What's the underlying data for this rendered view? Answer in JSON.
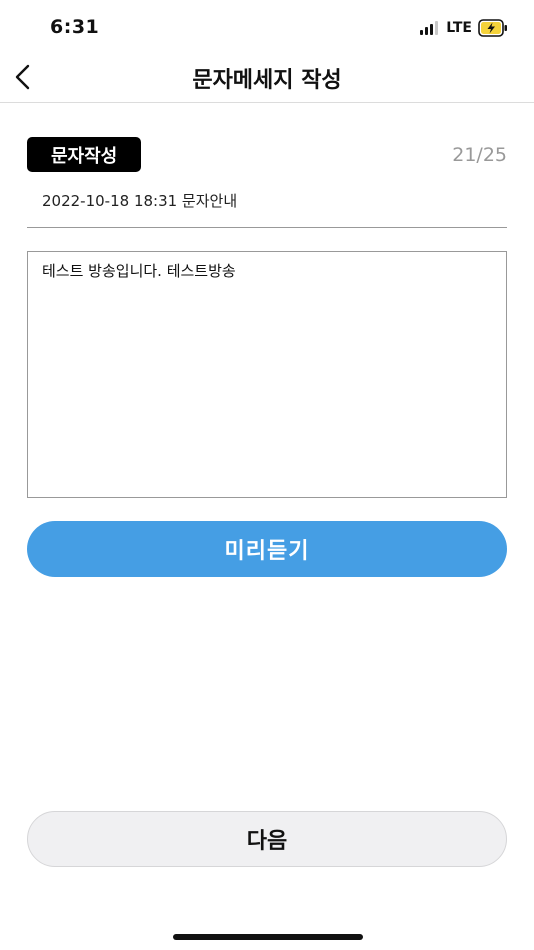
{
  "status_bar": {
    "time": "6:31",
    "network": "LTE",
    "battery_color": "#f5d33a"
  },
  "nav": {
    "title": "문자메세지 작성",
    "back_icon": "chevron-left-icon"
  },
  "compose": {
    "badge_label": "문자작성",
    "char_count": "21/25",
    "info": "2022-10-18 18:31 문자안내",
    "message_text": "테스트 방송입니다. 테스트방송"
  },
  "buttons": {
    "preview_label": "미리듣기",
    "next_label": "다음"
  },
  "colors": {
    "accent": "#459ee4",
    "badge_bg": "#000000",
    "secondary_button_bg": "#f0f0f2"
  }
}
